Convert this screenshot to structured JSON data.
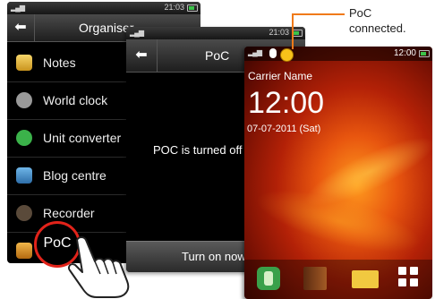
{
  "screen1": {
    "status_time": "21:03",
    "title": "Organiser",
    "items": [
      {
        "label": "Notes",
        "icon": "notes-icon"
      },
      {
        "label": "World clock",
        "icon": "world-clock-icon"
      },
      {
        "label": "Unit converter",
        "icon": "unit-converter-icon"
      },
      {
        "label": "Blog centre",
        "icon": "blog-centre-icon"
      },
      {
        "label": "Recorder",
        "icon": "recorder-icon"
      },
      {
        "label": "PoC",
        "icon": "poc-icon"
      }
    ]
  },
  "screen2": {
    "status_time": "21:03",
    "title": "PoC",
    "message": "POC is turned off",
    "button": "Turn on now"
  },
  "screen3": {
    "status_time": "12:00",
    "carrier": "Carrier Name",
    "clock": "12:00",
    "date": "07-07-2011 (Sat)"
  },
  "callout": {
    "line1": "PoC",
    "line2": "connected."
  },
  "colors": {
    "highlight": "#e2231a",
    "callout_line": "#f07a1a"
  }
}
